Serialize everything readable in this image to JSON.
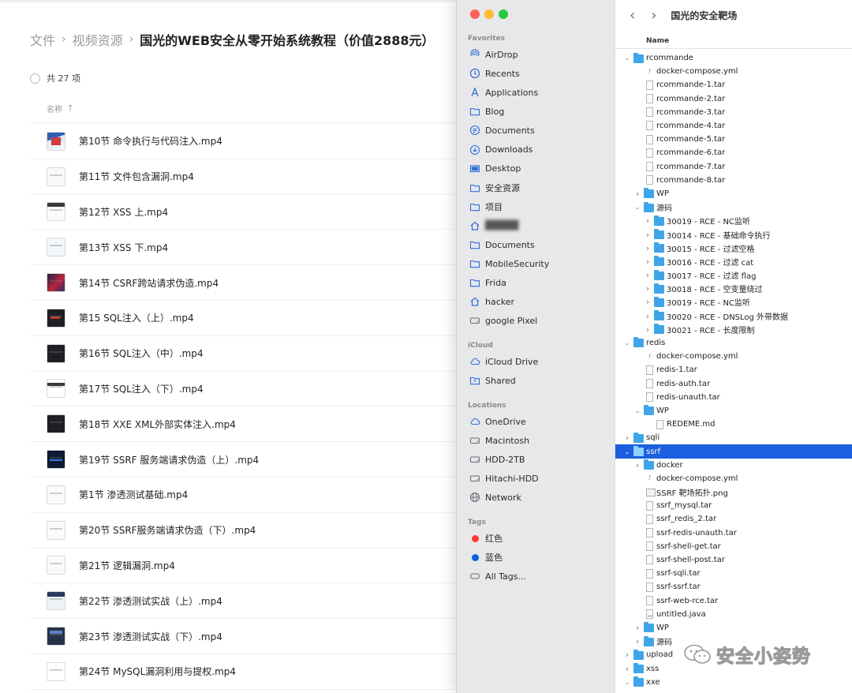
{
  "breadcrumb": {
    "items": [
      "文件",
      "视频资源"
    ],
    "current": "国光的WEB安全从零开始系统教程（价值2888元）"
  },
  "list_summary": {
    "count_label": "共 27 项"
  },
  "column_header": {
    "name": "名称",
    "sort_arrow": "↑"
  },
  "files": [
    "第10节 命令执行与代码注入.mp4",
    "第11节 文件包含漏洞.mp4",
    "第12节 XSS 上.mp4",
    "第13节 XSS 下.mp4",
    "第14节 CSRF跨站请求伪造.mp4",
    "第15 SQL注入（上）.mp4",
    "第16节 SQL注入（中）.mp4",
    "第17节 SQL注入（下）.mp4",
    "第18节 XXE XML外部实体注入.mp4",
    "第19节 SSRF 服务端请求伪造（上）.mp4",
    "第1节 渗透测试基础.mp4",
    "第20节 SSRF服务端请求伪造（下）.mp4",
    "第21节 逻辑漏洞.mp4",
    "第22节 渗透测试实战（上）.mp4",
    "第23节 渗透测试实战（下）.mp4",
    "第24节 MySQL漏洞利用与提权.mp4"
  ],
  "traffic_lights": {
    "close": "#ff5f57",
    "minimize": "#febc2e",
    "zoom": "#28c840"
  },
  "sidebar": {
    "favorites_title": "Favorites",
    "favorites": [
      {
        "label": "AirDrop",
        "icon": "airdrop"
      },
      {
        "label": "Recents",
        "icon": "clock"
      },
      {
        "label": "Applications",
        "icon": "apps"
      },
      {
        "label": "Blog",
        "icon": "folder"
      },
      {
        "label": "Documents",
        "icon": "doc"
      },
      {
        "label": "Downloads",
        "icon": "download"
      },
      {
        "label": "Desktop",
        "icon": "desktop"
      },
      {
        "label": "安全资源",
        "icon": "folder"
      },
      {
        "label": "项目",
        "icon": "folder"
      },
      {
        "label": "",
        "icon": "home-blurred"
      },
      {
        "label": "Documents",
        "icon": "folder"
      },
      {
        "label": "MobileSecurity",
        "icon": "folder"
      },
      {
        "label": "Frida",
        "icon": "folder"
      },
      {
        "label": "hacker",
        "icon": "home"
      },
      {
        "label": "google Pixel",
        "icon": "disk"
      }
    ],
    "icloud_title": "iCloud",
    "icloud": [
      {
        "label": "iCloud Drive",
        "icon": "cloud"
      },
      {
        "label": "Shared",
        "icon": "shared"
      }
    ],
    "locations_title": "Locations",
    "locations": [
      {
        "label": "OneDrive",
        "icon": "cloud"
      },
      {
        "label": "Macintosh",
        "icon": "disk"
      },
      {
        "label": "HDD-2TB",
        "icon": "disk"
      },
      {
        "label": "Hitachi-HDD",
        "icon": "disk"
      },
      {
        "label": "Network",
        "icon": "network"
      }
    ],
    "tags_title": "Tags",
    "tags": [
      {
        "label": "红色",
        "color": "#ff3b30"
      },
      {
        "label": "蓝色",
        "color": "#0a64d8"
      },
      {
        "label": "All Tags...",
        "color": ""
      }
    ]
  },
  "finder": {
    "title": "国光的安全靶场",
    "back": "‹",
    "forward": "›",
    "column_name": "Name",
    "selected_color": "#1a5fe0",
    "tree": [
      {
        "label": "rcommande",
        "depth": 0,
        "type": "folder",
        "disclosure": "open"
      },
      {
        "label": "docker-compose.yml",
        "depth": 1,
        "type": "yml",
        "disclosure": ""
      },
      {
        "label": "rcommande-1.tar",
        "depth": 1,
        "type": "file",
        "disclosure": ""
      },
      {
        "label": "rcommande-2.tar",
        "depth": 1,
        "type": "file",
        "disclosure": ""
      },
      {
        "label": "rcommande-3.tar",
        "depth": 1,
        "type": "file",
        "disclosure": ""
      },
      {
        "label": "rcommande-4.tar",
        "depth": 1,
        "type": "file",
        "disclosure": ""
      },
      {
        "label": "rcommande-5.tar",
        "depth": 1,
        "type": "file",
        "disclosure": ""
      },
      {
        "label": "rcommande-6.tar",
        "depth": 1,
        "type": "file",
        "disclosure": ""
      },
      {
        "label": "rcommande-7.tar",
        "depth": 1,
        "type": "file",
        "disclosure": ""
      },
      {
        "label": "rcommande-8.tar",
        "depth": 1,
        "type": "file",
        "disclosure": ""
      },
      {
        "label": "WP",
        "depth": 1,
        "type": "folder",
        "disclosure": "closed"
      },
      {
        "label": "源码",
        "depth": 1,
        "type": "folder",
        "disclosure": "open"
      },
      {
        "label": " 30019 - RCE - NC监听",
        "depth": 2,
        "type": "folder",
        "disclosure": "closed"
      },
      {
        "label": "30014 - RCE - 基础命令执行",
        "depth": 2,
        "type": "folder",
        "disclosure": "closed"
      },
      {
        "label": "30015 - RCE - 过滤空格",
        "depth": 2,
        "type": "folder",
        "disclosure": "closed"
      },
      {
        "label": "30016 - RCE - 过滤 cat",
        "depth": 2,
        "type": "folder",
        "disclosure": "closed"
      },
      {
        "label": "30017 - RCE - 过滤 flag",
        "depth": 2,
        "type": "folder",
        "disclosure": "closed"
      },
      {
        "label": "30018 - RCE - 空变量绕过",
        "depth": 2,
        "type": "folder",
        "disclosure": "closed"
      },
      {
        "label": "30019 - RCE - NC监听",
        "depth": 2,
        "type": "folder",
        "disclosure": "closed"
      },
      {
        "label": "30020 - RCE - DNSLog 外带数据",
        "depth": 2,
        "type": "folder",
        "disclosure": "closed"
      },
      {
        "label": "30021 - RCE - 长度限制",
        "depth": 2,
        "type": "folder",
        "disclosure": "closed"
      },
      {
        "label": "redis",
        "depth": 0,
        "type": "folder",
        "disclosure": "open"
      },
      {
        "label": "docker-compose.yml",
        "depth": 1,
        "type": "yml",
        "disclosure": ""
      },
      {
        "label": "redis-1.tar",
        "depth": 1,
        "type": "file",
        "disclosure": ""
      },
      {
        "label": "redis-auth.tar",
        "depth": 1,
        "type": "file",
        "disclosure": ""
      },
      {
        "label": "redis-unauth.tar",
        "depth": 1,
        "type": "file",
        "disclosure": ""
      },
      {
        "label": "WP",
        "depth": 1,
        "type": "folder",
        "disclosure": "open"
      },
      {
        "label": "REDEME.md",
        "depth": 2,
        "type": "file",
        "disclosure": ""
      },
      {
        "label": "sqli",
        "depth": 0,
        "type": "folder",
        "disclosure": "closed"
      },
      {
        "label": "ssrf",
        "depth": 0,
        "type": "folder",
        "disclosure": "open",
        "selected": true
      },
      {
        "label": "docker",
        "depth": 1,
        "type": "folder",
        "disclosure": "closed"
      },
      {
        "label": "docker-compose.yml",
        "depth": 1,
        "type": "yml",
        "disclosure": ""
      },
      {
        "label": "SSRF 靶场拓扑.png",
        "depth": 1,
        "type": "image",
        "disclosure": ""
      },
      {
        "label": "ssrf_mysql.tar",
        "depth": 1,
        "type": "file",
        "disclosure": ""
      },
      {
        "label": "ssrf_redis_2.tar",
        "depth": 1,
        "type": "file",
        "disclosure": ""
      },
      {
        "label": "ssrf-redis-unauth.tar",
        "depth": 1,
        "type": "file",
        "disclosure": ""
      },
      {
        "label": "ssrf-shell-get.tar",
        "depth": 1,
        "type": "file",
        "disclosure": ""
      },
      {
        "label": "ssrf-shell-post.tar",
        "depth": 1,
        "type": "file",
        "disclosure": ""
      },
      {
        "label": "ssrf-sqli.tar",
        "depth": 1,
        "type": "file",
        "disclosure": ""
      },
      {
        "label": "ssrf-ssrf.tar",
        "depth": 1,
        "type": "file",
        "disclosure": ""
      },
      {
        "label": "ssrf-web-rce.tar",
        "depth": 1,
        "type": "file",
        "disclosure": ""
      },
      {
        "label": "untitled.java",
        "depth": 1,
        "type": "java",
        "disclosure": ""
      },
      {
        "label": "WP",
        "depth": 1,
        "type": "folder",
        "disclosure": "closed"
      },
      {
        "label": "源码",
        "depth": 1,
        "type": "folder",
        "disclosure": "closed"
      },
      {
        "label": "upload",
        "depth": 0,
        "type": "folder",
        "disclosure": "closed"
      },
      {
        "label": "xss",
        "depth": 0,
        "type": "folder",
        "disclosure": "closed"
      },
      {
        "label": "xxe",
        "depth": 0,
        "type": "folder",
        "disclosure": "open"
      }
    ]
  },
  "watermark": {
    "text": "安全小姿势",
    "icon": "wechat-icon"
  }
}
